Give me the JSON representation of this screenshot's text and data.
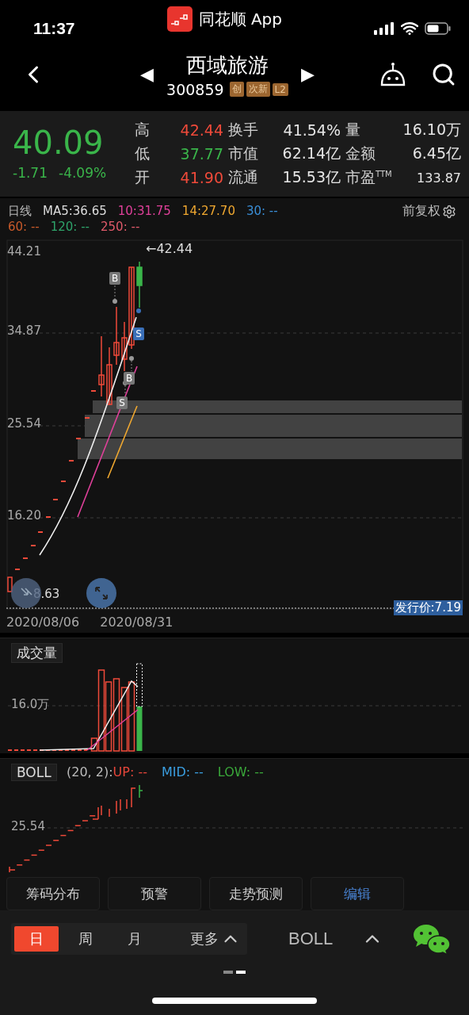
{
  "status_bar": {
    "time": "11:37",
    "app_label": "同花顺 App"
  },
  "header": {
    "prev_arrow": "◀",
    "title": "西域旅游",
    "code": "300859",
    "tags": [
      "创",
      "次新",
      "L2"
    ],
    "next_arrow": "▶"
  },
  "quote": {
    "price": "40.09",
    "change": "-1.71",
    "change_pct": "-4.09%",
    "color": "#3ab54a",
    "stats": [
      {
        "label": "高",
        "value": "42.44",
        "color": "#f04a3a"
      },
      {
        "label": "换手",
        "value": "41.54%",
        "color": "#e6e6e6"
      },
      {
        "label": "量",
        "value": "16.10万",
        "color": "#e6e6e6"
      },
      {
        "label": "低",
        "value": "37.77",
        "color": "#3ab54a"
      },
      {
        "label": "市值",
        "value": "62.14亿",
        "color": "#e6e6e6"
      },
      {
        "label": "金额",
        "value": "6.45亿",
        "color": "#e6e6e6"
      },
      {
        "label": "开",
        "value": "41.90",
        "color": "#f04a3a"
      },
      {
        "label": "流通",
        "value": "15.53亿",
        "color": "#e6e6e6"
      },
      {
        "label": "市盈$^{TTM}$",
        "value": "133.87",
        "color": "#e6e6e6"
      }
    ]
  },
  "chart": {
    "period_label": "日线",
    "indicators": [
      {
        "text": "MA5:36.65",
        "color": "#dddddd"
      },
      {
        "text": "10:31.75",
        "color": "#e0409a"
      },
      {
        "text": "14:27.70",
        "color": "#f0a830"
      },
      {
        "text": "30: --",
        "color": "#3a8fd8"
      },
      {
        "text": "60: --",
        "color": "#c85a2a"
      },
      {
        "text": "120: --",
        "color": "#2ea36a"
      },
      {
        "text": "250: --",
        "color": "#e05a6a"
      }
    ],
    "adjust_label": "前复权",
    "y_labels": [
      "44.21",
      "34.87",
      "25.54",
      "16.20"
    ],
    "low_label": "8.63",
    "high_marker": "←42.44",
    "signals": [
      {
        "text": "B",
        "color": "#777777"
      },
      {
        "text": "S",
        "color": "#3a6fb8"
      },
      {
        "text": "B",
        "color": "#777777"
      },
      {
        "text": "S",
        "color": "#777777"
      }
    ],
    "issue_price": "发行价:7.19",
    "dates": [
      "2020/08/06",
      "2020/08/31"
    ]
  },
  "volume": {
    "label": "成交量",
    "y_label": "16.0万"
  },
  "boll": {
    "label": "BOLL",
    "params": "(20, 2):",
    "lines": [
      {
        "text": "UP: --",
        "color": "#e8463a"
      },
      {
        "text": "MID: --",
        "color": "#3a9ee0"
      },
      {
        "text": "LOW: --",
        "color": "#3aa83a"
      }
    ],
    "y_label": "25.54"
  },
  "tools": [
    {
      "label": "筹码分布",
      "accent": false
    },
    {
      "label": "预警",
      "accent": false
    },
    {
      "label": "走势预测",
      "accent": false
    },
    {
      "label": "编辑",
      "accent": true
    }
  ],
  "bottom": {
    "periods": [
      {
        "label": "日",
        "selected": true
      },
      {
        "label": "周",
        "selected": false
      },
      {
        "label": "月",
        "selected": false
      }
    ],
    "more": "更多",
    "indicator": "BOLL"
  },
  "page_dots": [
    {
      "selected": false
    },
    {
      "selected": true
    }
  ]
}
